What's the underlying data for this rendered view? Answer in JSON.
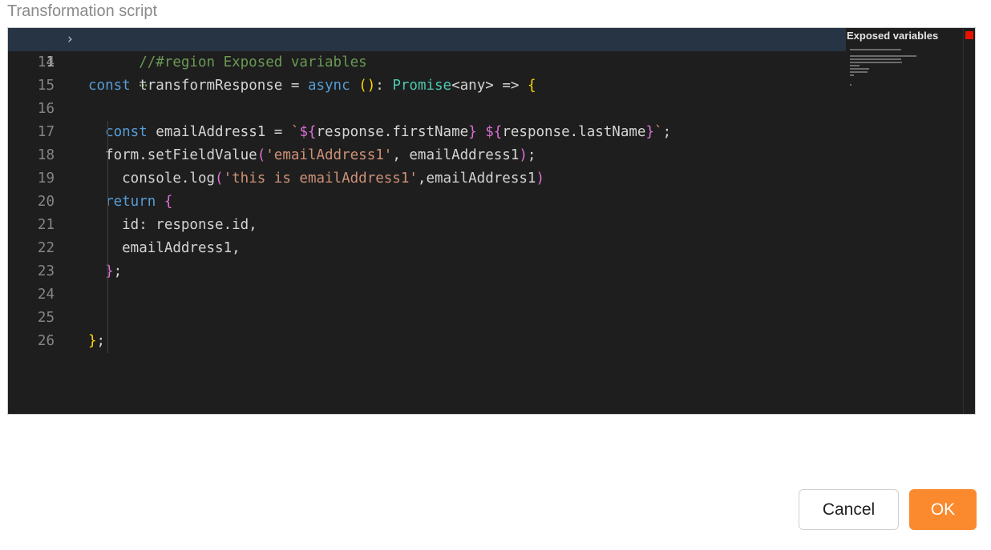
{
  "field_label": "Transformation script",
  "editor": {
    "folded_region": {
      "line_number": "1",
      "text": "//#region Exposed variables",
      "ellipsis": "⋯"
    },
    "lines": [
      {
        "n": "14",
        "tokens": []
      },
      {
        "n": "15",
        "tokens": [
          {
            "t": "const",
            "c": "kw"
          },
          {
            "t": " transformResponse = ",
            "c": "id"
          },
          {
            "t": "async",
            "c": "kw"
          },
          {
            "t": " ",
            "c": "id"
          },
          {
            "t": "()",
            "c": "p1"
          },
          {
            "t": ": ",
            "c": "id"
          },
          {
            "t": "Promise",
            "c": "ty"
          },
          {
            "t": "<any> => ",
            "c": "id"
          },
          {
            "t": "{",
            "c": "p1"
          }
        ]
      },
      {
        "n": "16",
        "tokens": []
      },
      {
        "n": "17",
        "tokens": [
          {
            "t": "  const",
            "c": "kw"
          },
          {
            "t": " emailAddress1 = ",
            "c": "id"
          },
          {
            "t": "`",
            "c": "str"
          },
          {
            "t": "${",
            "c": "p2"
          },
          {
            "t": "response.firstName",
            "c": "id"
          },
          {
            "t": "}",
            "c": "p2"
          },
          {
            "t": " ",
            "c": "str"
          },
          {
            "t": "${",
            "c": "p2"
          },
          {
            "t": "response.lastName",
            "c": "id"
          },
          {
            "t": "}",
            "c": "p2"
          },
          {
            "t": "`",
            "c": "str"
          },
          {
            "t": ";",
            "c": "id"
          }
        ]
      },
      {
        "n": "18",
        "tokens": [
          {
            "t": "  form.setFieldValue",
            "c": "id"
          },
          {
            "t": "(",
            "c": "p2"
          },
          {
            "t": "'emailAddress1'",
            "c": "str"
          },
          {
            "t": ", emailAddress1",
            "c": "id"
          },
          {
            "t": ")",
            "c": "p2"
          },
          {
            "t": ";",
            "c": "id"
          }
        ]
      },
      {
        "n": "19",
        "tokens": [
          {
            "t": "    console.log",
            "c": "id"
          },
          {
            "t": "(",
            "c": "p2"
          },
          {
            "t": "'this is emailAddress1'",
            "c": "str"
          },
          {
            "t": ",emailAddress1",
            "c": "id"
          },
          {
            "t": ")",
            "c": "p2"
          }
        ]
      },
      {
        "n": "20",
        "tokens": [
          {
            "t": "  return",
            "c": "kw"
          },
          {
            "t": " ",
            "c": "id"
          },
          {
            "t": "{",
            "c": "p2"
          }
        ]
      },
      {
        "n": "21",
        "tokens": [
          {
            "t": "    id: response.id,",
            "c": "id"
          }
        ]
      },
      {
        "n": "22",
        "tokens": [
          {
            "t": "    emailAddress1,",
            "c": "id"
          }
        ]
      },
      {
        "n": "23",
        "tokens": [
          {
            "t": "  ",
            "c": "id"
          },
          {
            "t": "}",
            "c": "p2"
          },
          {
            "t": ";",
            "c": "id"
          }
        ]
      },
      {
        "n": "24",
        "tokens": []
      },
      {
        "n": "25",
        "tokens": []
      },
      {
        "n": "26",
        "tokens": [
          {
            "t": "}",
            "c": "p1"
          },
          {
            "t": ";",
            "c": "id"
          }
        ]
      }
    ],
    "minimap_title": "Exposed variables",
    "colors": {
      "background": "#1e1e1e",
      "keyword": "#569cd6",
      "string": "#ce9178",
      "comment": "#6a9955",
      "type": "#4ec9b0",
      "bracket_gold": "#ffd700",
      "bracket_purple": "#da70d6",
      "error_marker": "#e51400"
    }
  },
  "buttons": {
    "cancel_label": "Cancel",
    "ok_label": "OK",
    "ok_color": "#fa8a2d"
  }
}
